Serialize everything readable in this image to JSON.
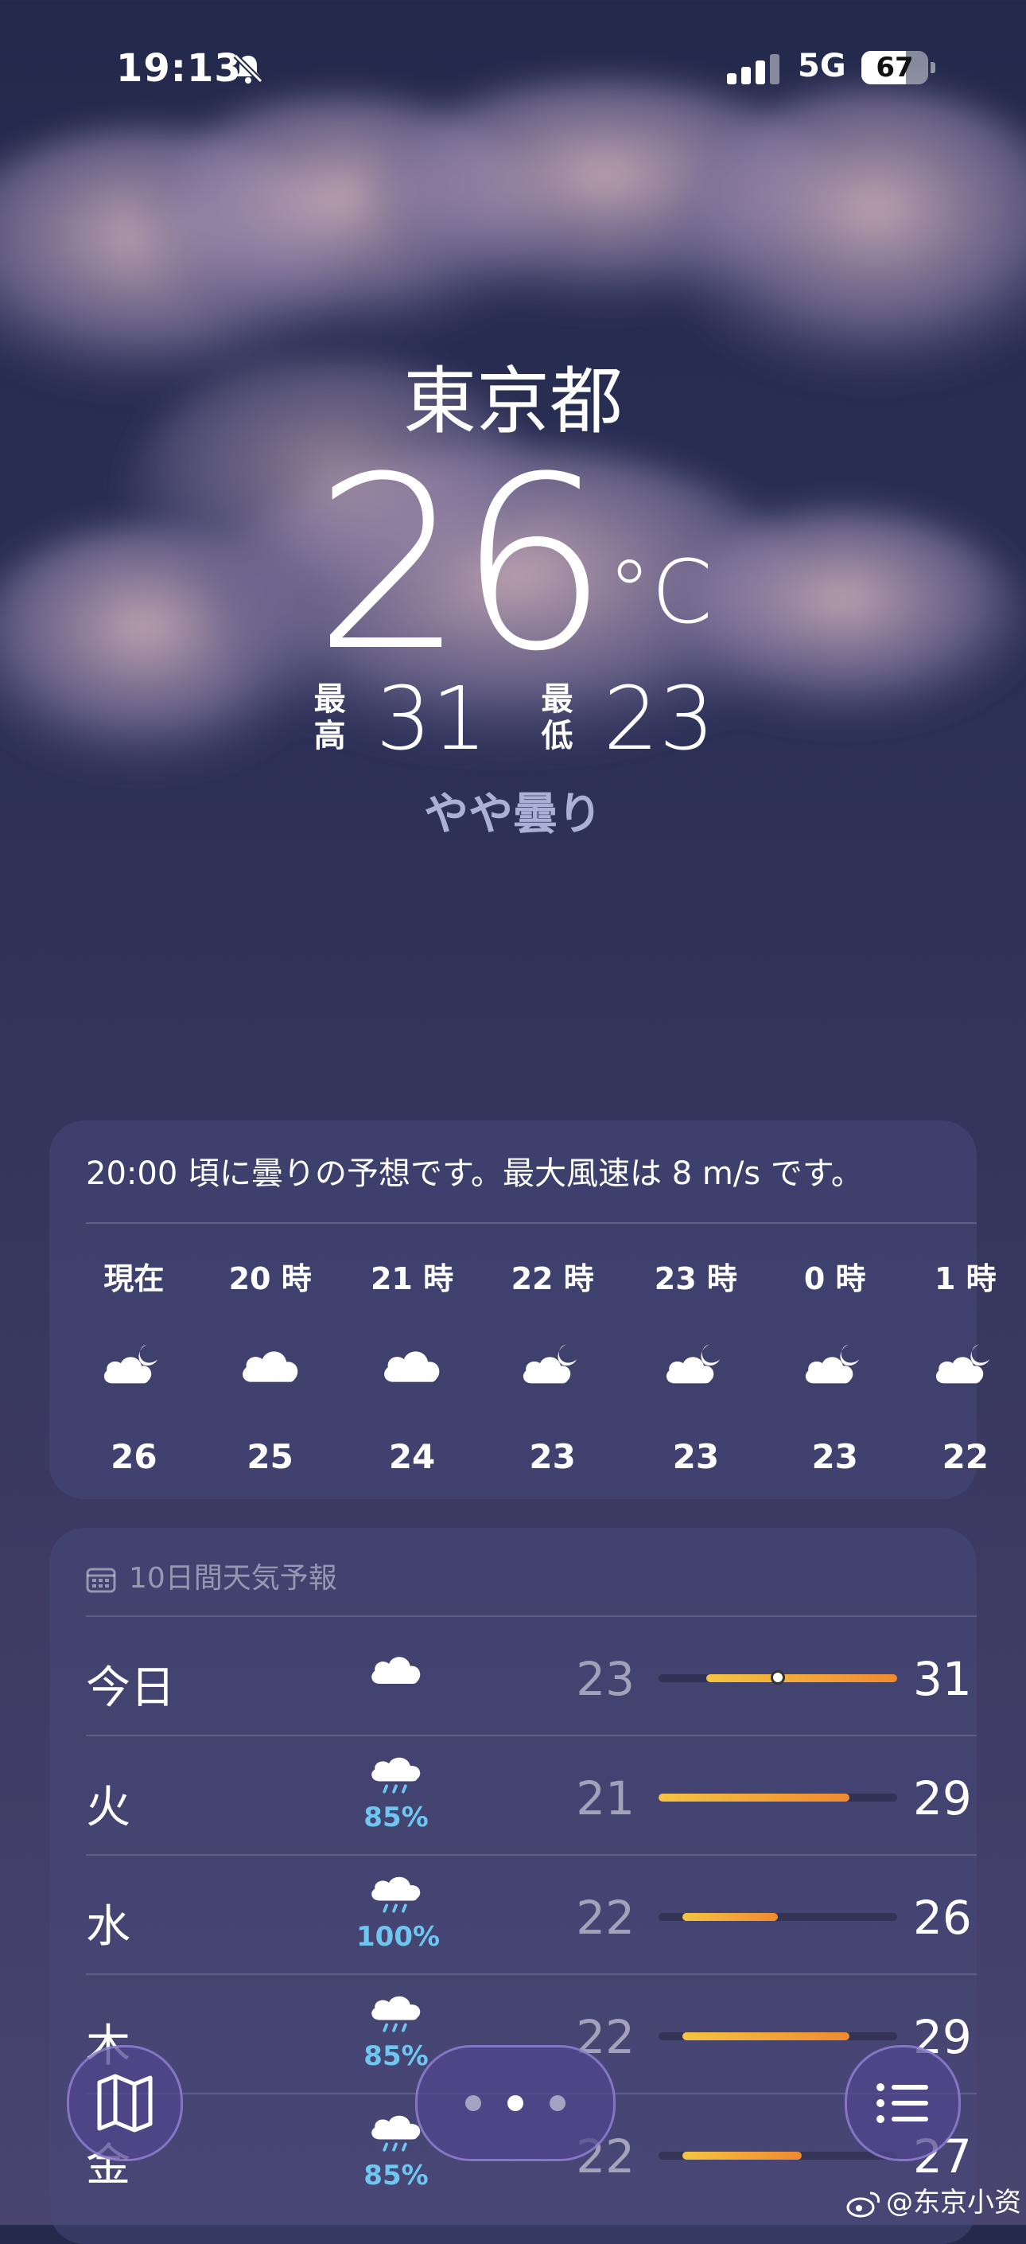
{
  "status": {
    "time": "19:13",
    "network": "5G",
    "battery": "67",
    "battery_level": 0.67
  },
  "hero": {
    "city": "東京都",
    "temp": "26",
    "unit": "°C",
    "high_label": "最高",
    "high": "31",
    "low_label": "最低",
    "low": "23",
    "condition": "やや曇り"
  },
  "hourly": {
    "summary": "20:00 頃に曇りの予想です。最大風速は 8 m/s です。",
    "items": [
      {
        "label": "現在",
        "icon": "cloud-moon-icon",
        "temp": "26"
      },
      {
        "label": "20 時",
        "icon": "cloud-icon",
        "temp": "25"
      },
      {
        "label": "21 時",
        "icon": "cloud-icon",
        "temp": "24"
      },
      {
        "label": "22 時",
        "icon": "cloud-moon-icon",
        "temp": "23"
      },
      {
        "label": "23 時",
        "icon": "cloud-moon-icon",
        "temp": "23"
      },
      {
        "label": "0 時",
        "icon": "cloud-moon-icon",
        "temp": "23"
      },
      {
        "label": "1 時",
        "icon": "cloud-moon-icon",
        "temp": "22"
      }
    ]
  },
  "daily": {
    "header": "10日間天気予報",
    "range_min": 21,
    "range_max": 31,
    "current_temp": 26,
    "days": [
      {
        "day": "今日",
        "icon": "cloud-icon",
        "prob": "",
        "low": "23",
        "high": "31"
      },
      {
        "day": "火",
        "icon": "cloud-rain-icon",
        "prob": "85%",
        "low": "21",
        "high": "29"
      },
      {
        "day": "水",
        "icon": "cloud-rain-icon",
        "prob": "100%",
        "low": "22",
        "high": "26"
      },
      {
        "day": "木",
        "icon": "cloud-rain-icon",
        "prob": "85%",
        "low": "22",
        "high": "29"
      },
      {
        "day": "金",
        "icon": "cloud-rain-icon",
        "prob": "85%",
        "low": "22",
        "high": "27"
      }
    ]
  },
  "colors": {
    "accent_rain": "#6fc6f0",
    "bar_start": "#f4c542",
    "bar_end": "#f08a30"
  },
  "watermark": "@东京小资"
}
